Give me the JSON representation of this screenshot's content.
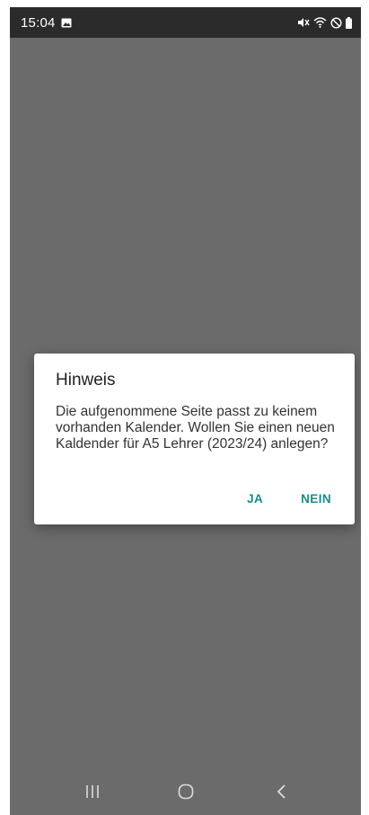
{
  "status_bar": {
    "time": "15:04",
    "icons": [
      "image-notification-icon",
      "mute-icon",
      "wifi-icon",
      "do-not-disturb-icon",
      "battery-icon"
    ]
  },
  "dialog": {
    "title": "Hinweis",
    "message": "Die aufgenommene Seite passt zu keinem vorhanden Kalender. Wollen Sie einen neuen Kaldender für A5 Lehrer (2023/24) anlegen?",
    "positive_button": "JA",
    "negative_button": "NEIN"
  },
  "colors": {
    "scrim": "#6b6b6b",
    "status_bar": "#2b2b2b",
    "accent": "#1f8a8a"
  },
  "nav_bar": {
    "icons": [
      "recent-apps-icon",
      "home-icon",
      "back-icon"
    ]
  }
}
